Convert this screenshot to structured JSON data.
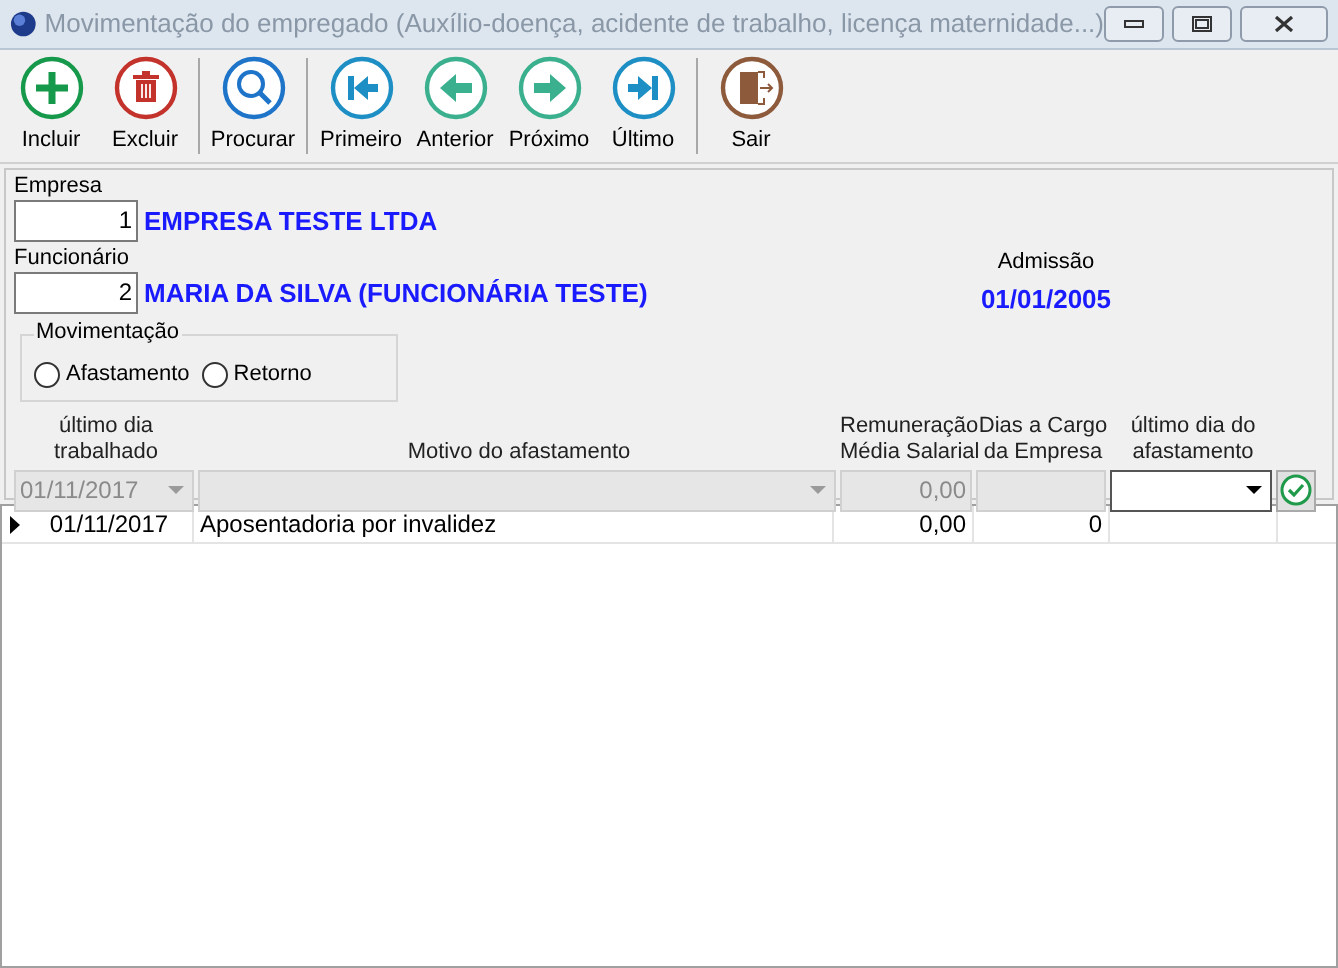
{
  "window": {
    "title": "Movimentação do empregado (Auxílio-doença, acidente de trabalho, licença maternidade...)"
  },
  "toolbar_groups": [
    [
      {
        "label": "Incluir",
        "kind": "add"
      },
      {
        "label": "Excluir",
        "kind": "delete"
      }
    ],
    [
      {
        "label": "Procurar",
        "kind": "search"
      }
    ],
    [
      {
        "label": "Primeiro",
        "kind": "first"
      },
      {
        "label": "Anterior",
        "kind": "prev"
      },
      {
        "label": "Próximo",
        "kind": "next"
      },
      {
        "label": "Último",
        "kind": "last"
      }
    ],
    [
      {
        "label": "Sair",
        "kind": "exit"
      }
    ]
  ],
  "empresa": {
    "label": "Empresa",
    "code": "1",
    "name": "EMPRESA TESTE LTDA"
  },
  "funcionario": {
    "label": "Funcionário",
    "code": "2",
    "name": "MARIA DA SILVA (FUNCIONÁRIA TESTE)"
  },
  "admissao": {
    "label": "Admissão",
    "value": "01/01/2005"
  },
  "movimentacao": {
    "label": "Movimentação",
    "options": [
      {
        "label": "Afastamento",
        "selected": false
      },
      {
        "label": "Retorno",
        "selected": false
      }
    ]
  },
  "entry": {
    "columns": [
      "último dia\ntrabalhado",
      "Motivo do afastamento",
      "Remuneração\nMédia Salarial",
      "Dias a Cargo\nda Empresa",
      "último dia do\nafastamento"
    ],
    "fields": [
      {
        "kind": "combo",
        "value": "01/11/2017",
        "disabled": true
      },
      {
        "kind": "combo",
        "disabled": true
      },
      {
        "kind": "text",
        "value": "0,00",
        "disabled": true
      },
      {
        "kind": "text",
        "disabled": true
      },
      {
        "kind": "combo",
        "disabled": false
      }
    ]
  },
  "grid": {
    "rows": [
      {
        "selected": true,
        "cells": [
          "01/11/2017",
          "Aposentadoria por invalidez",
          "0,00",
          "0"
        ]
      }
    ]
  }
}
